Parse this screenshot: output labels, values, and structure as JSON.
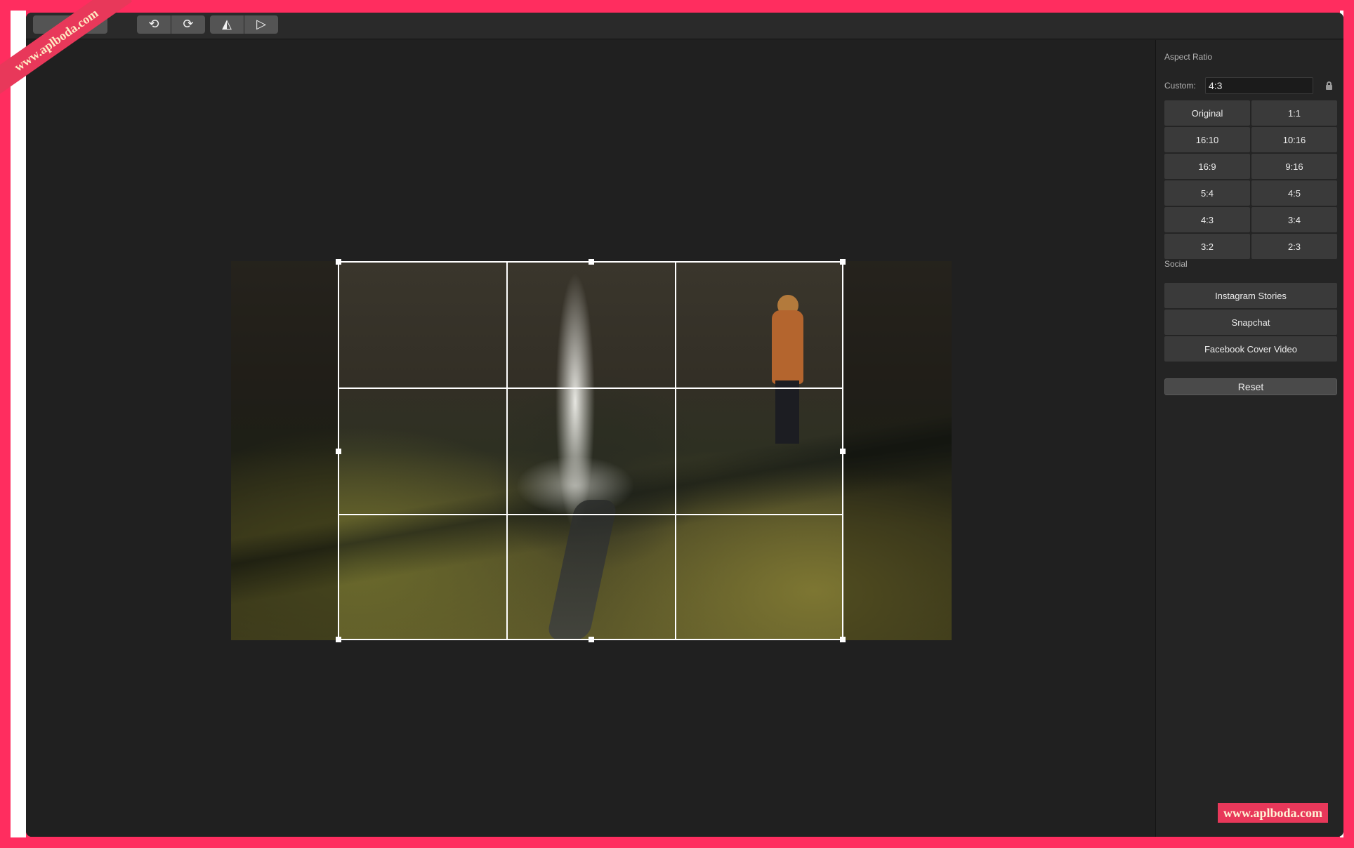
{
  "toolbar": {
    "left_group_icon": "document-icon",
    "undo_icon": "undo-arrow-icon",
    "undo_glyph": "⟲",
    "redo_icon": "redo-arrow-icon",
    "redo_glyph": "⟳",
    "flip_horizontal_icon": "flip-horizontal-icon",
    "flip_horizontal_glyph": "◭",
    "flip_vertical_icon": "flip-vertical-icon",
    "flip_vertical_glyph": "▷"
  },
  "canvas": {
    "image_description_visible": false
  },
  "panel": {
    "aspect_ratio_title": "Aspect Ratio",
    "custom_label": "Custom:",
    "custom_value": "4:3",
    "lock_icon": "lock-icon",
    "ratios": [
      "Original",
      "1:1",
      "16:10",
      "10:16",
      "16:9",
      "9:16",
      "5:4",
      "4:5",
      "4:3",
      "3:4",
      "3:2",
      "2:3"
    ],
    "social_title": "Social",
    "social": [
      "Instagram Stories",
      "Snapchat",
      "Facebook Cover Video"
    ],
    "reset_label": "Reset"
  },
  "watermark": {
    "ribbon_text": "www.aplboda.com",
    "badge_text": "www.aplboda.com"
  },
  "colors": {
    "frame": "#ff2d5f",
    "window_bg": "#202020",
    "panel_bg": "#242424",
    "button_bg": "#3a3a3a",
    "crop_line": "#ffffff"
  }
}
